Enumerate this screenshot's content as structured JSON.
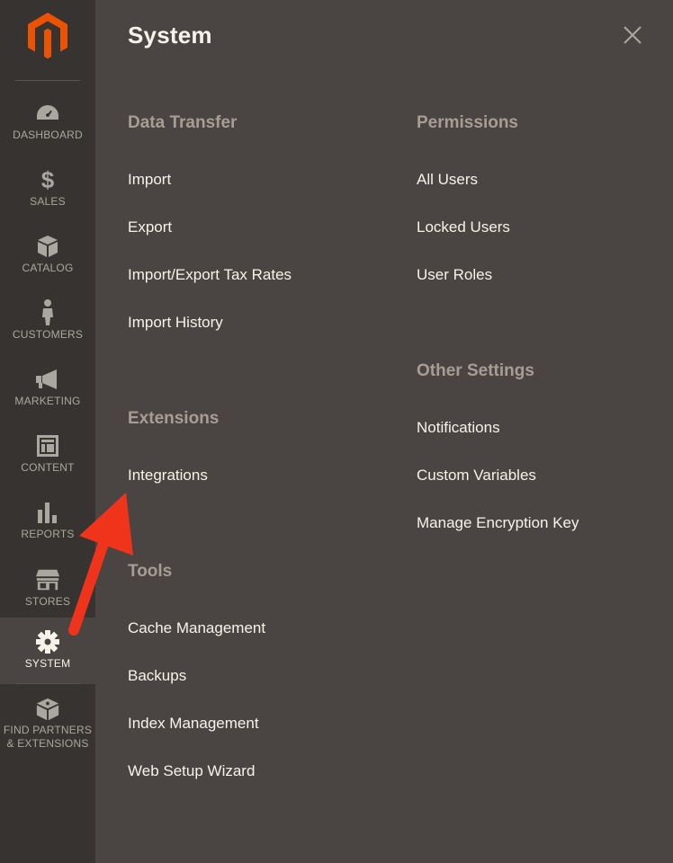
{
  "sidebar": {
    "items": [
      {
        "label": "DASHBOARD",
        "icon": "dashboard-icon"
      },
      {
        "label": "SALES",
        "icon": "dollar-icon"
      },
      {
        "label": "CATALOG",
        "icon": "box-icon"
      },
      {
        "label": "CUSTOMERS",
        "icon": "person-icon"
      },
      {
        "label": "MARKETING",
        "icon": "megaphone-icon"
      },
      {
        "label": "CONTENT",
        "icon": "layout-icon"
      },
      {
        "label": "REPORTS",
        "icon": "bar-chart-icon"
      },
      {
        "label": "STORES",
        "icon": "storefront-icon"
      },
      {
        "label": "SYSTEM",
        "icon": "gear-icon",
        "active": true
      },
      {
        "label_line1": "FIND PARTNERS",
        "label_line2": "& EXTENSIONS",
        "icon": "blocks-icon"
      }
    ]
  },
  "panel": {
    "title": "System",
    "close_icon": "close-icon",
    "columns": {
      "left": {
        "data_transfer": {
          "title": "Data Transfer",
          "items": [
            "Import",
            "Export",
            "Import/Export Tax Rates",
            "Import History"
          ]
        },
        "extensions": {
          "title": "Extensions",
          "items": [
            "Integrations"
          ]
        },
        "tools": {
          "title": "Tools",
          "items": [
            "Cache Management",
            "Backups",
            "Index Management",
            "Web Setup Wizard"
          ]
        }
      },
      "right": {
        "permissions": {
          "title": "Permissions",
          "items": [
            "All Users",
            "Locked Users",
            "User Roles"
          ]
        },
        "other_settings": {
          "title": "Other Settings",
          "items": [
            "Notifications",
            "Custom Variables",
            "Manage Encryption Key"
          ]
        }
      }
    }
  },
  "colors": {
    "sidebar_bg": "#373330",
    "panel_bg": "#4a4542",
    "text": "#f7f3eb",
    "section_title": "#a79d95",
    "logo_orange": "#eb5202",
    "annotation_arrow": "#f0341b"
  }
}
